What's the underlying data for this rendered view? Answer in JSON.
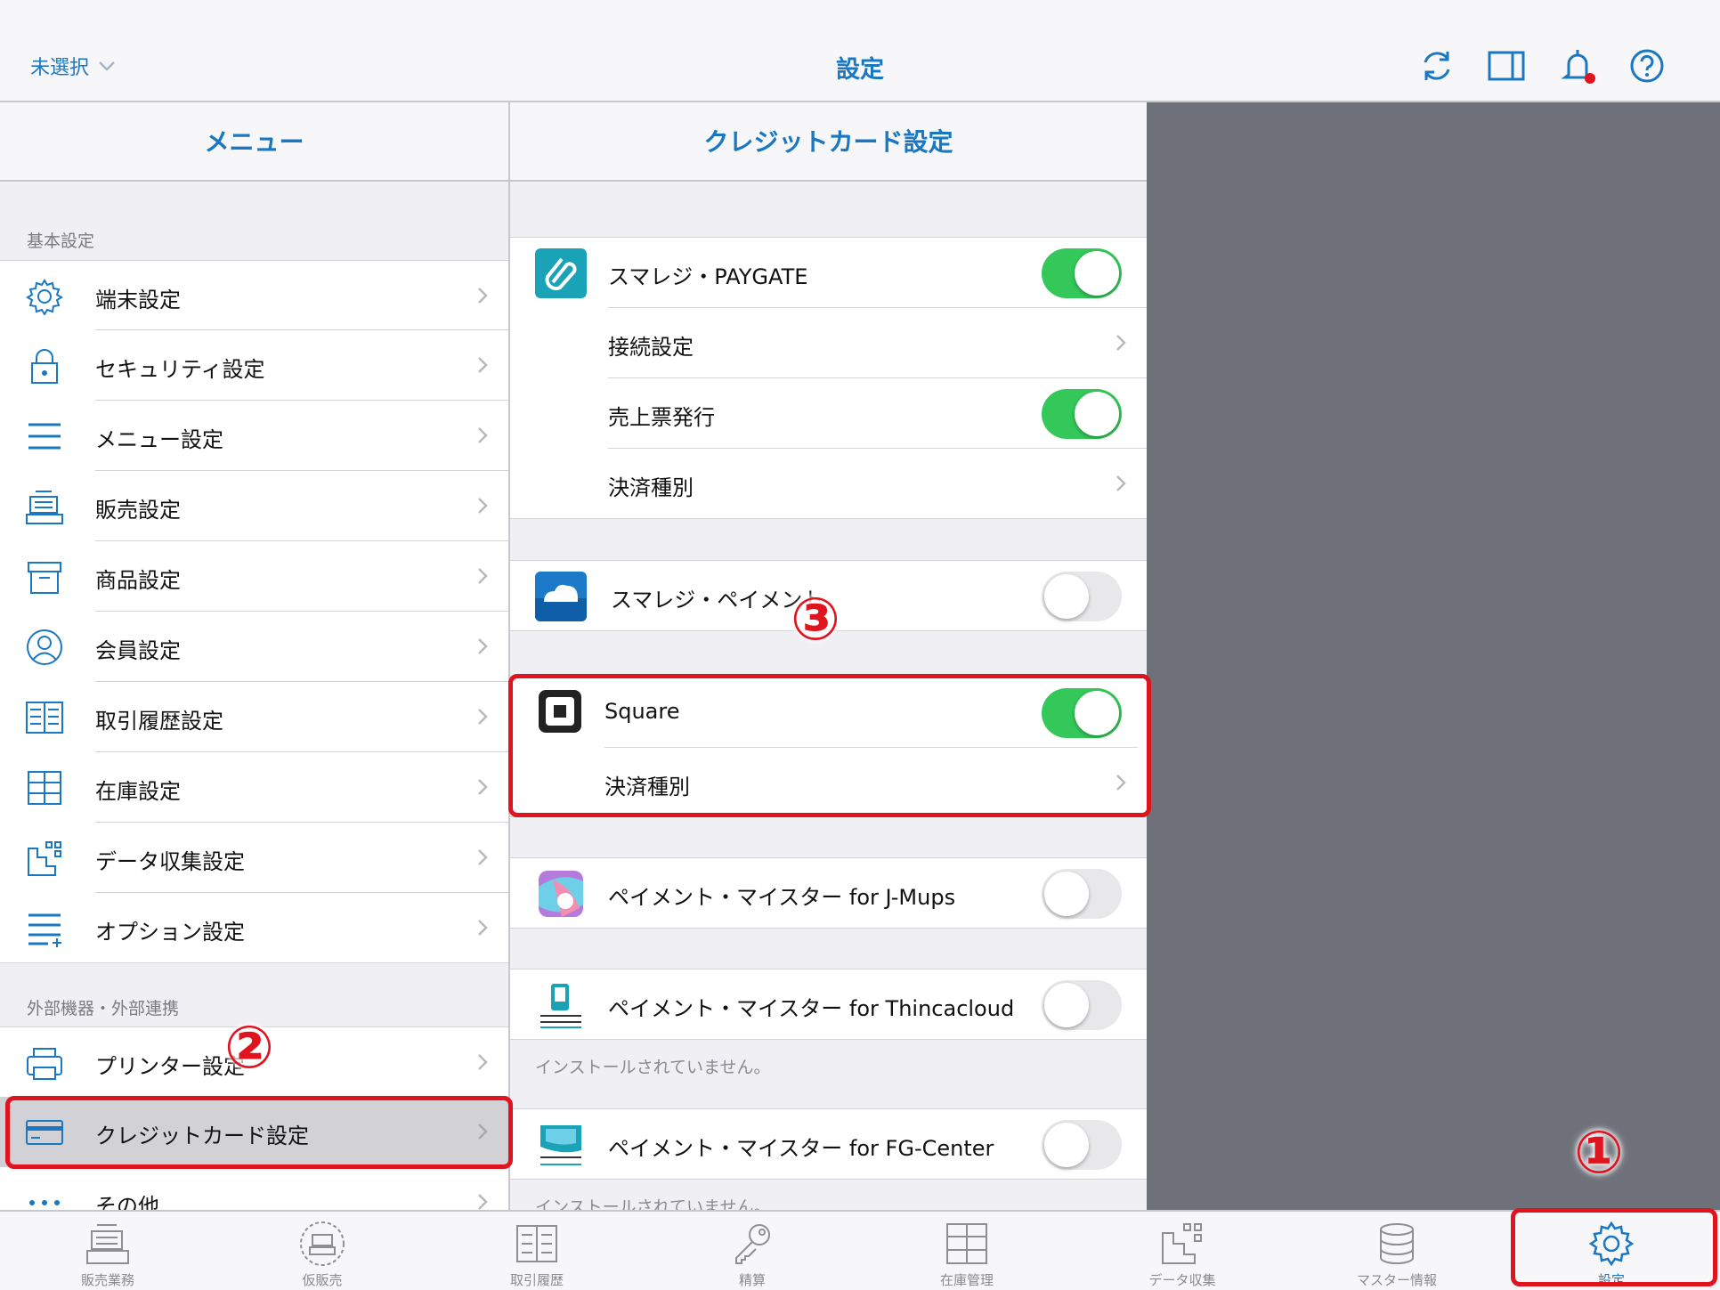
{
  "header": {
    "selector_label": "未選択",
    "title": "設定"
  },
  "menu": {
    "title": "メニュー",
    "section_basic": "基本設定",
    "items": [
      {
        "label": "端末設定",
        "icon": "gear-icon"
      },
      {
        "label": "セキュリティ設定",
        "icon": "lock-icon"
      },
      {
        "label": "メニュー設定",
        "icon": "menu-lines-icon"
      },
      {
        "label": "販売設定",
        "icon": "register-icon"
      },
      {
        "label": "商品設定",
        "icon": "box-icon"
      },
      {
        "label": "会員設定",
        "icon": "user-icon"
      },
      {
        "label": "取引履歴設定",
        "icon": "book-icon"
      },
      {
        "label": "在庫設定",
        "icon": "cabinet-icon"
      },
      {
        "label": "データ収集設定",
        "icon": "data-icon"
      },
      {
        "label": "オプション設定",
        "icon": "options-icon"
      }
    ],
    "section_external": "外部機器・外部連携",
    "external_items": [
      {
        "label": "プリンター設定",
        "icon": "printer-icon"
      },
      {
        "label": "クレジットカード設定",
        "icon": "credit-card-icon"
      },
      {
        "label": "その他",
        "icon": "more-icon"
      }
    ]
  },
  "credit": {
    "title": "クレジットカード設定",
    "paygate": {
      "label": "スマレジ・PAYGATE",
      "enabled": true,
      "connection": "接続設定",
      "receipt": "売上票発行",
      "receipt_enabled": true,
      "payment_type": "決済種別"
    },
    "payment": {
      "label": "スマレジ・ペイメント",
      "enabled": false
    },
    "square": {
      "label": "Square",
      "enabled": true,
      "payment_type": "決済種別"
    },
    "jmups": {
      "label": "ペイメント・マイスター for J-Mups",
      "enabled": false
    },
    "thinca": {
      "label": "ペイメント・マイスター for Thincacloud",
      "enabled": false,
      "note": "インストールされていません。"
    },
    "fg": {
      "label": "ペイメント・マイスター for FG-Center",
      "enabled": false,
      "note": "インストールされていません。"
    }
  },
  "tabbar": [
    {
      "label": "販売業務",
      "icon": "register-icon"
    },
    {
      "label": "仮販売",
      "icon": "temp-register-icon"
    },
    {
      "label": "取引履歴",
      "icon": "book-icon"
    },
    {
      "label": "精算",
      "icon": "key-icon"
    },
    {
      "label": "在庫管理",
      "icon": "cabinet-icon"
    },
    {
      "label": "データ収集",
      "icon": "data-icon"
    },
    {
      "label": "マスター情報",
      "icon": "database-icon"
    },
    {
      "label": "設定",
      "icon": "gear-icon"
    }
  ],
  "annotations": {
    "one": "①",
    "two": "②",
    "three": "③"
  },
  "colors": {
    "accent": "#1a78c2",
    "toggle_on": "#34c759",
    "highlight": "#e0141e"
  }
}
